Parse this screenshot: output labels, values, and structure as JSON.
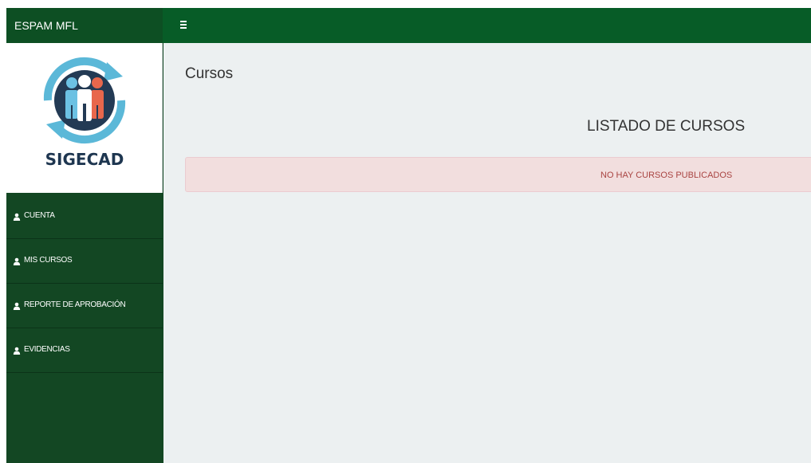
{
  "header": {
    "brand": "ESPAM MFL"
  },
  "logo": {
    "text": "SIGECAD"
  },
  "sidebar": {
    "items": [
      {
        "label": "CUENTA"
      },
      {
        "label": "MIS CURSOS"
      },
      {
        "label": "REPORTE DE APROBACIÓN"
      },
      {
        "label": "EVIDENCIAS"
      }
    ]
  },
  "main": {
    "page_title": "Cursos",
    "list_title": "LISTADO DE CURSOS",
    "alert_text": "NO HAY CURSOS PUBLICADOS"
  },
  "colors": {
    "topbar": "#075c27",
    "brand_bg": "#0d4f23",
    "sidebar": "#134723",
    "content_bg": "#ecf0f1",
    "alert_bg": "#f2dede",
    "alert_text": "#a94442"
  },
  "icons": {
    "menu_toggle": "hamburger-icon",
    "nav_item": "user-icon"
  }
}
